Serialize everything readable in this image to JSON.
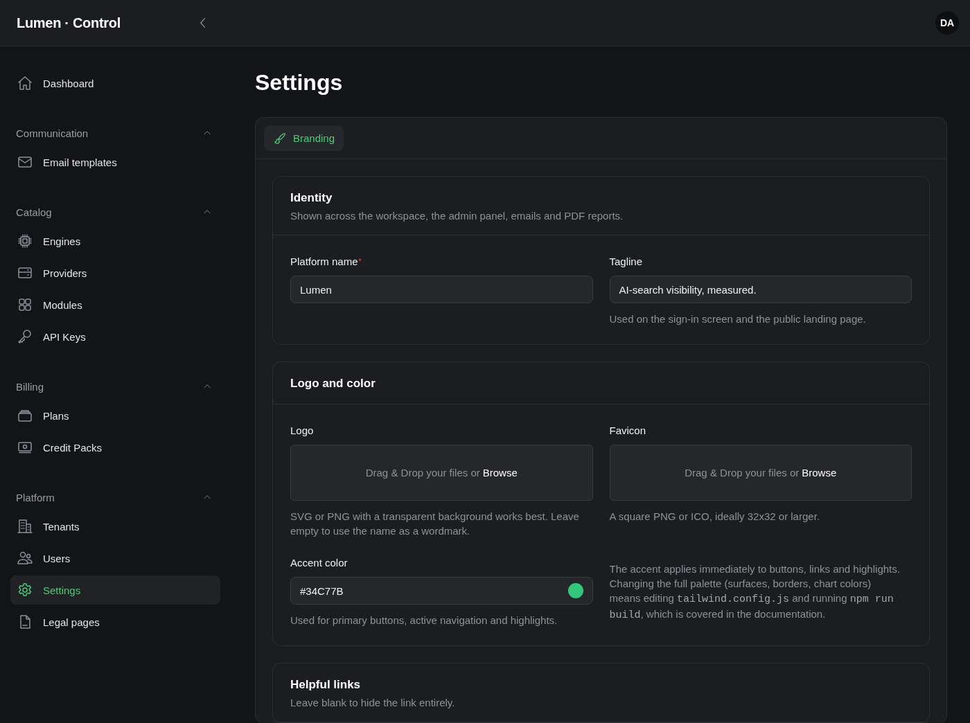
{
  "header": {
    "brand": "Lumen · Control",
    "avatar": "DA"
  },
  "sidebar": {
    "items": [
      {
        "kind": "link",
        "label": "Dashboard",
        "selected": false
      },
      {
        "kind": "group",
        "label": "Communication",
        "expanded": true,
        "children": [
          {
            "kind": "link",
            "label": "Email templates",
            "selected": false
          }
        ]
      },
      {
        "kind": "group",
        "label": "Catalog",
        "expanded": true,
        "children": [
          {
            "kind": "link",
            "label": "Engines",
            "selected": false
          },
          {
            "kind": "link",
            "label": "Providers",
            "selected": false
          },
          {
            "kind": "link",
            "label": "Modules",
            "selected": false
          },
          {
            "kind": "link",
            "label": "API Keys",
            "selected": false
          }
        ]
      },
      {
        "kind": "group",
        "label": "Billing",
        "expanded": true,
        "children": [
          {
            "kind": "link",
            "label": "Plans",
            "selected": false
          },
          {
            "kind": "link",
            "label": "Credit Packs",
            "selected": false
          }
        ]
      },
      {
        "kind": "group",
        "label": "Platform",
        "expanded": true,
        "children": [
          {
            "kind": "link",
            "label": "Tenants",
            "selected": false
          },
          {
            "kind": "link",
            "label": "Users",
            "selected": false
          },
          {
            "kind": "link",
            "label": "Settings",
            "selected": true
          },
          {
            "kind": "link",
            "label": "Legal pages",
            "selected": false
          }
        ]
      }
    ]
  },
  "page": {
    "title": "Settings"
  },
  "tabs": [
    {
      "label": "Branding",
      "selected": true
    }
  ],
  "sections": [
    {
      "title": "Identity",
      "description": "Shown across the workspace, the admin panel, emails and PDF reports.",
      "fields": [
        {
          "kind": "text",
          "label": "Platform name",
          "marker": "*",
          "value": "Lumen"
        },
        {
          "kind": "text",
          "label": "Tagline",
          "value": "AI-search visibility, measured.",
          "hint": "Used on the sign-in screen and the public landing page."
        }
      ]
    },
    {
      "title": "Logo and color",
      "fields": [
        {
          "kind": "upload",
          "label": "Logo",
          "prompt": "Drag & Drop your files or",
          "link": "Browse",
          "hint": "SVG or PNG with a transparent background works best. Leave empty to use the name as a wordmark."
        },
        {
          "kind": "upload",
          "label": "Favicon",
          "prompt": "Drag & Drop your files or",
          "link": "Browse",
          "hint": "A square PNG or ICO, ideally 32x32 or larger."
        },
        {
          "kind": "color",
          "label": "Accent color",
          "value": "#34C77B",
          "hint": "Used for primary buttons, active navigation and highlights."
        },
        {
          "kind": "note",
          "segments": [
            {
              "kind": "text",
              "text": "The accent applies immediately to buttons, links and highlights. Changing the full palette (surfaces, borders, chart colors) means editing "
            },
            {
              "kind": "code",
              "text": "tailwind.config.js"
            },
            {
              "kind": "text",
              "text": " and running "
            },
            {
              "kind": "code",
              "text": "npm run build"
            },
            {
              "kind": "text",
              "text": ", which is covered in the documentation."
            }
          ]
        }
      ]
    },
    {
      "title": "Helpful links",
      "description": "Leave blank to hide the link entirely."
    }
  ]
}
